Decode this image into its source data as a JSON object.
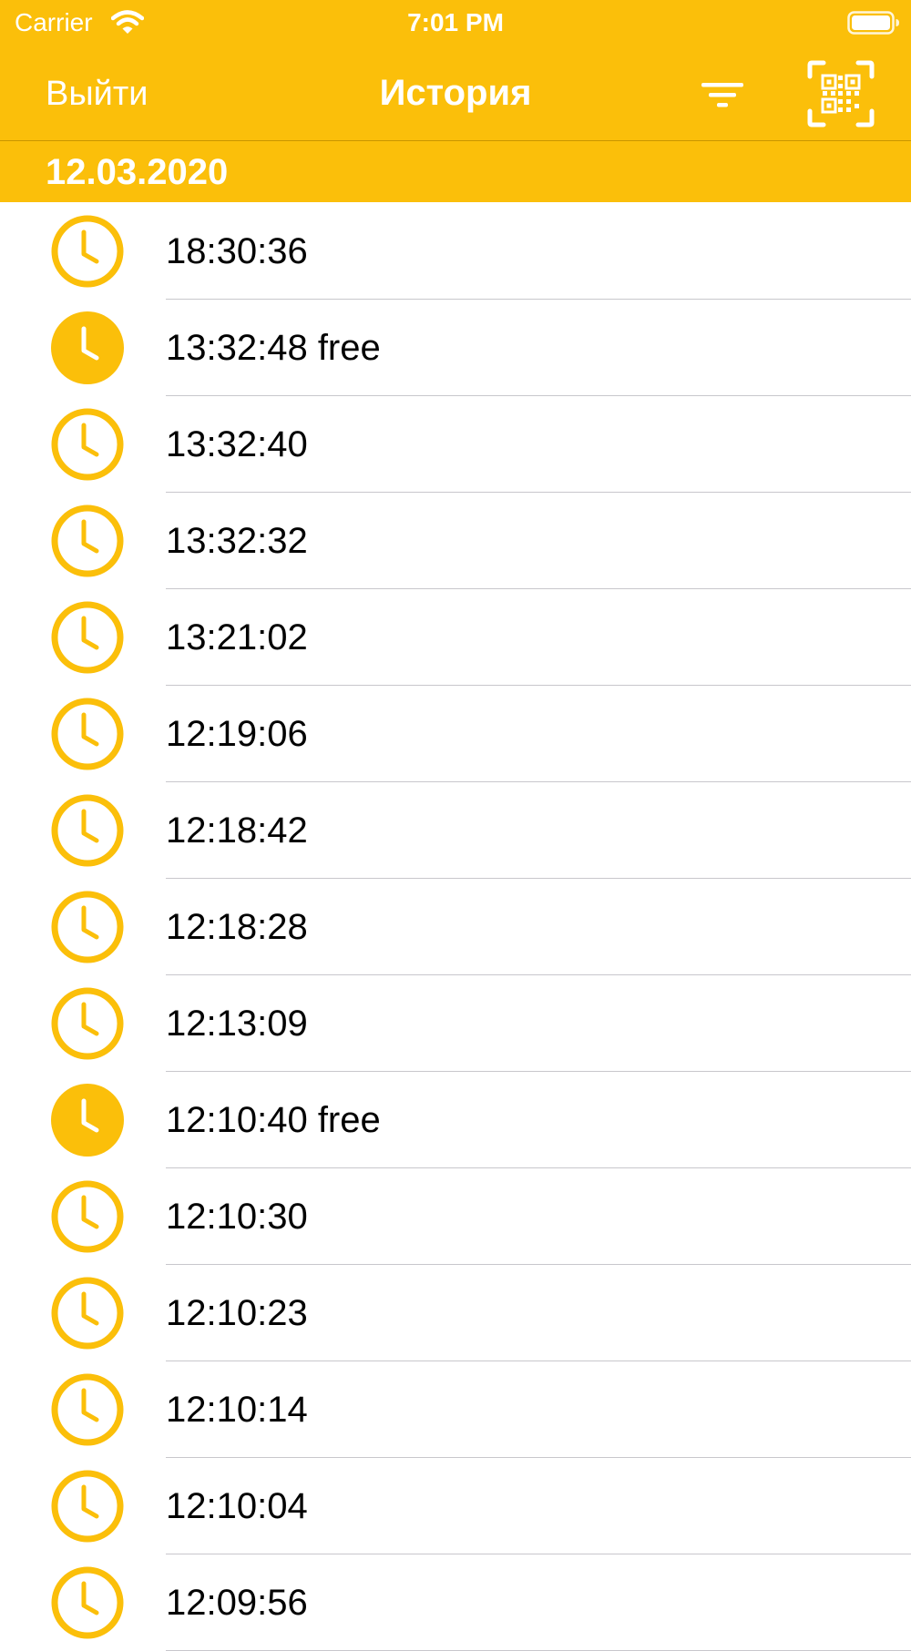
{
  "colors": {
    "accent": "#FBBF0A",
    "text": "#000000",
    "on_accent": "#FFFFFF",
    "separator": "#C8C7CC"
  },
  "status_bar": {
    "carrier": "Carrier",
    "time": "7:01 PM",
    "icons": [
      "wifi-icon",
      "battery-icon"
    ]
  },
  "nav": {
    "left_label": "Выйти",
    "title": "История",
    "filter_icon": "filter-icon",
    "qr_icon": "qr-scan-icon"
  },
  "section": {
    "date": "12.03.2020"
  },
  "history": [
    {
      "label": "18:30:36",
      "free": false
    },
    {
      "label": "13:32:48 free",
      "free": true
    },
    {
      "label": "13:32:40",
      "free": false
    },
    {
      "label": "13:32:32",
      "free": false
    },
    {
      "label": "13:21:02",
      "free": false
    },
    {
      "label": "12:19:06",
      "free": false
    },
    {
      "label": "12:18:42",
      "free": false
    },
    {
      "label": "12:18:28",
      "free": false
    },
    {
      "label": "12:13:09",
      "free": false
    },
    {
      "label": "12:10:40 free",
      "free": true
    },
    {
      "label": "12:10:30",
      "free": false
    },
    {
      "label": "12:10:23",
      "free": false
    },
    {
      "label": "12:10:14",
      "free": false
    },
    {
      "label": "12:10:04",
      "free": false
    },
    {
      "label": "12:09:56",
      "free": false
    }
  ]
}
